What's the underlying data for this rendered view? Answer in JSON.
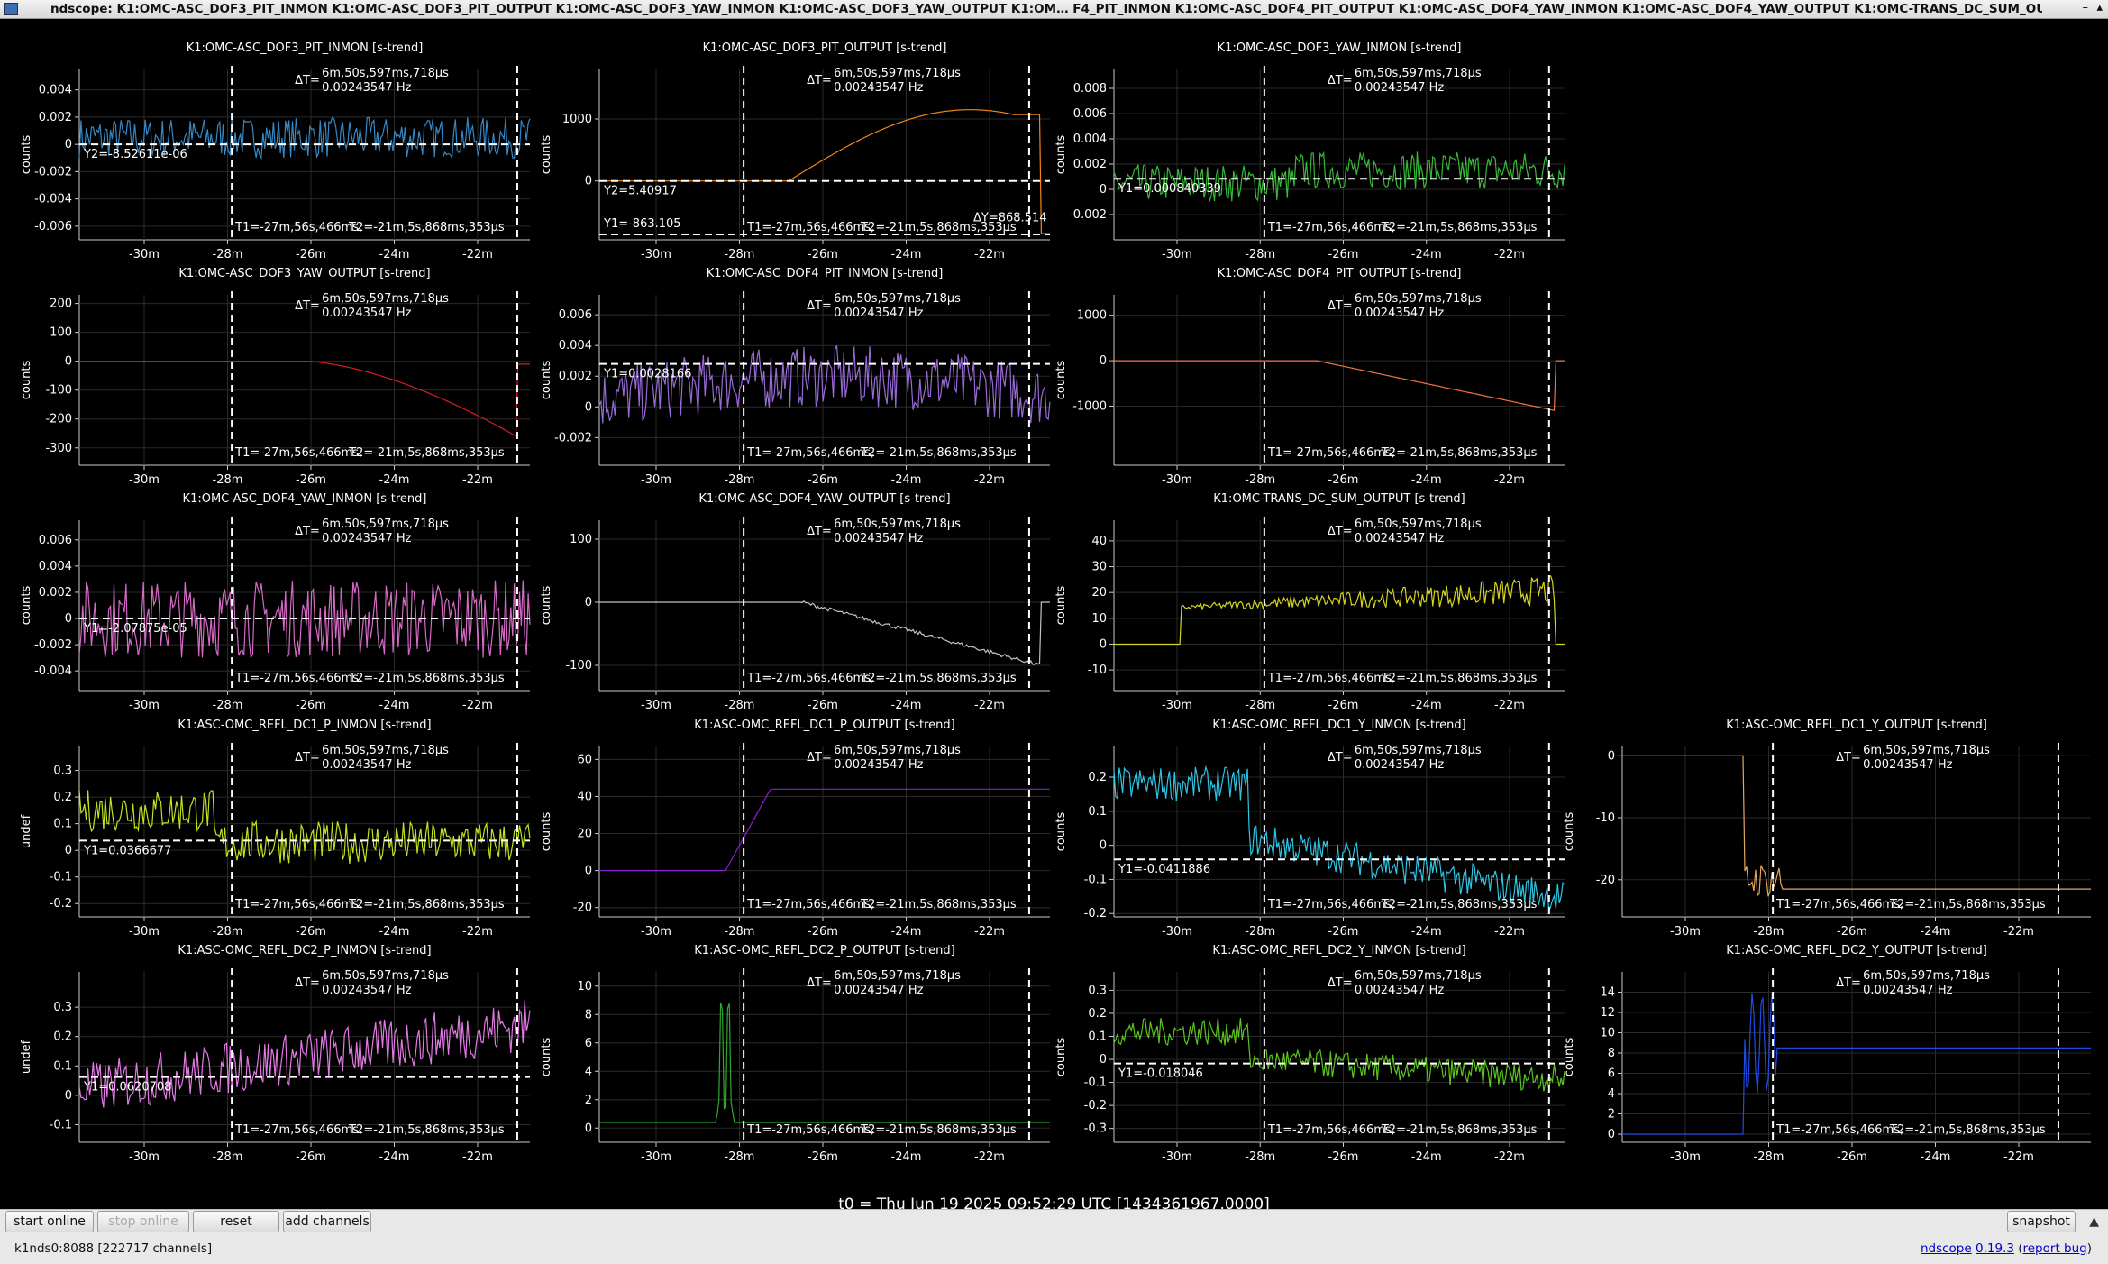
{
  "window": {
    "title": "ndscope: K1:OMC-ASC_DOF3_PIT_INMON K1:OMC-ASC_DOF3_PIT_OUTPUT K1:OMC-ASC_DOF3_YAW_INMON K1:OMC-ASC_DOF3_YAW_OUTPUT K1:OM…  F4_PIT_INMON K1:OMC-ASC_DOF4_PIT_OUTPUT K1:OMC-ASC_DOF4_YAW_INMON K1:OMC-ASC_DOF4_YAW_OUTPUT K1:OMC-TRANS_DC_SUM_OUTPUT",
    "minimize": "–",
    "maximize": "▴"
  },
  "cursor": {
    "dt": "ΔT=",
    "dt_val": "6m,50s,597ms,718µs",
    "dt_hz": "0.00243547 Hz",
    "t1": "T1=-27m,56s,466ms,",
    "t2": "T2=-21m,5s,868ms,353µs"
  },
  "xticks": [
    "-30m",
    "-28m",
    "-26m",
    "-24m",
    "-22m"
  ],
  "plots": [
    {
      "title": "K1:OMC-ASC_DOF3_PIT_INMON [s-trend]",
      "ylabel": "counts",
      "color": "#3a8fd0",
      "ymin": -0.007,
      "ymax": 0.0055,
      "yticks": [
        "0.004",
        "0.002",
        "0",
        "-0.002",
        "-0.004",
        "-0.006"
      ],
      "ytickv": [
        0.004,
        0.002,
        0,
        -0.002,
        -0.004,
        -0.006
      ],
      "ycursor": "Y2=-8.52611e-06",
      "ycurv": 0
    },
    {
      "title": "K1:OMC-ASC_DOF3_PIT_OUTPUT [s-trend]",
      "ylabel": "counts",
      "color": "#ff8c1a",
      "ymin": -950,
      "ymax": 1800,
      "yticks": [
        "1000",
        "0"
      ],
      "ytickv": [
        1000,
        0
      ],
      "ycursor": "Y2=5.40917",
      "ycurv": 0,
      "ycursor2": "Y1=-863.105",
      "ycurv2": -863,
      "dy": "ΔY=868.514"
    },
    {
      "title": "K1:OMC-ASC_DOF3_YAW_INMON [s-trend]",
      "ylabel": "counts",
      "color": "#3ac23a",
      "ymin": -0.004,
      "ymax": 0.0095,
      "yticks": [
        "0.008",
        "0.006",
        "0.004",
        "0.002",
        "0",
        "-0.002"
      ],
      "ytickv": [
        0.008,
        0.006,
        0.004,
        0.002,
        0,
        -0.002
      ],
      "ycursor": "Y1=0.000840339",
      "ycurv": 0.00084
    },
    {
      "title": "K1:OMC-ASC_DOF3_YAW_OUTPUT [s-trend]",
      "ylabel": "counts",
      "color": "#e02020",
      "ymin": -360,
      "ymax": 230,
      "yticks": [
        "200",
        "100",
        "0",
        "-100",
        "-200",
        "-300"
      ],
      "ytickv": [
        200,
        100,
        0,
        -100,
        -200,
        -300
      ]
    },
    {
      "title": "K1:OMC-ASC_DOF4_PIT_INMON [s-trend]",
      "ylabel": "counts",
      "color": "#a070e0",
      "ymin": -0.0038,
      "ymax": 0.0073,
      "yticks": [
        "0.006",
        "0.004",
        "0.002",
        "0",
        "-0.002"
      ],
      "ytickv": [
        0.006,
        0.004,
        0.002,
        0,
        -0.002
      ],
      "ycursor": "Y1=0.0028166",
      "ycurv": 0.0028
    },
    {
      "title": "K1:OMC-ASC_DOF4_PIT_OUTPUT [s-trend]",
      "ylabel": "counts",
      "color": "#ff7a40",
      "ymin": -2300,
      "ymax": 1450,
      "yticks": [
        "1000",
        "0",
        "-1000"
      ],
      "ytickv": [
        1000,
        0,
        -1000
      ]
    },
    {
      "title": "K1:OMC-ASC_DOF4_YAW_INMON [s-trend]",
      "ylabel": "counts",
      "color": "#e070d0",
      "ymin": -0.0055,
      "ymax": 0.0075,
      "yticks": [
        "0.006",
        "0.004",
        "0.002",
        "0",
        "-0.002",
        "-0.004"
      ],
      "ytickv": [
        0.006,
        0.004,
        0.002,
        0,
        -0.002,
        -0.004
      ],
      "ycursor": "Y1=-2.07875e-05",
      "ycurv": 0
    },
    {
      "title": "K1:OMC-ASC_DOF4_YAW_OUTPUT [s-trend]",
      "ylabel": "counts",
      "color": "#cccccc",
      "ymin": -140,
      "ymax": 130,
      "yticks": [
        "100",
        "0",
        "-100"
      ],
      "ytickv": [
        100,
        0,
        -100
      ]
    },
    {
      "title": "K1:OMC-TRANS_DC_SUM_OUTPUT [s-trend]",
      "ylabel": "counts",
      "color": "#e0e020",
      "ymin": -18,
      "ymax": 48,
      "yticks": [
        "40",
        "30",
        "20",
        "10",
        "0",
        "-10"
      ],
      "ytickv": [
        40,
        30,
        20,
        10,
        0,
        -10
      ]
    },
    {
      "title": "K1:ASC-OMC_REFL_DC1_P_INMON [s-trend]",
      "ylabel": "undef",
      "color": "#c8f020",
      "ymin": -0.25,
      "ymax": 0.39,
      "yticks": [
        "0.3",
        "0.2",
        "0.1",
        "0",
        "-0.1",
        "-0.2"
      ],
      "ytickv": [
        0.3,
        0.2,
        0.1,
        0,
        -0.1,
        -0.2
      ],
      "ycursor": "Y1=0.0366677",
      "ycurv": 0.0367
    },
    {
      "title": "K1:ASC-OMC_REFL_DC1_P_OUTPUT [s-trend]",
      "ylabel": "counts",
      "color": "#9020e0",
      "ymin": -25,
      "ymax": 67,
      "yticks": [
        "60",
        "40",
        "20",
        "0",
        "-20"
      ],
      "ytickv": [
        60,
        40,
        20,
        0,
        -20
      ]
    },
    {
      "title": "K1:ASC-OMC_REFL_DC1_Y_INMON [s-trend]",
      "ylabel": "counts",
      "color": "#30d0f0",
      "ymin": -0.21,
      "ymax": 0.29,
      "yticks": [
        "0.2",
        "0.1",
        "0",
        "-0.1",
        "-0.2"
      ],
      "ytickv": [
        0.2,
        0.1,
        0,
        -0.1,
        -0.2
      ],
      "ycursor": "Y1=-0.0411886",
      "ycurv": -0.0412
    },
    {
      "title": "K1:ASC-OMC_REFL_DC1_Y_OUTPUT [s-trend]",
      "ylabel": "counts",
      "color": "#f0b060",
      "ymin": -26,
      "ymax": 1.5,
      "yticks": [
        "0",
        "-10",
        "-20"
      ],
      "ytickv": [
        0,
        -10,
        -20
      ]
    },
    {
      "title": "K1:ASC-OMC_REFL_DC2_P_INMON [s-trend]",
      "ylabel": "undef",
      "color": "#f080f0",
      "ymin": -0.16,
      "ymax": 0.42,
      "yticks": [
        "0.3",
        "0.2",
        "0.1",
        "0",
        "-0.1"
      ],
      "ytickv": [
        0.3,
        0.2,
        0.1,
        0,
        -0.1
      ],
      "ycursor": "Y1=0.0620708",
      "ycurv": 0.062
    },
    {
      "title": "K1:ASC-OMC_REFL_DC2_P_OUTPUT [s-trend]",
      "ylabel": "counts",
      "color": "#30b030",
      "ymin": -1,
      "ymax": 11,
      "yticks": [
        "10",
        "8",
        "6",
        "4",
        "2",
        "0"
      ],
      "ytickv": [
        10,
        8,
        6,
        4,
        2,
        0
      ]
    },
    {
      "title": "K1:ASC-OMC_REFL_DC2_Y_INMON [s-trend]",
      "ylabel": "counts",
      "color": "#60d020",
      "ymin": -0.36,
      "ymax": 0.38,
      "yticks": [
        "0.3",
        "0.2",
        "0.1",
        "0",
        "-0.1",
        "-0.2",
        "-0.3"
      ],
      "ytickv": [
        0.3,
        0.2,
        0.1,
        0,
        -0.1,
        -0.2,
        -0.3
      ],
      "ycursor": "Y1=-0.018046",
      "ycurv": -0.018
    },
    {
      "title": "K1:ASC-OMC_REFL_DC2_Y_OUTPUT [s-trend]",
      "ylabel": "counts",
      "color": "#2050f0",
      "ymin": -0.8,
      "ymax": 16,
      "yticks": [
        "14",
        "12",
        "10",
        "8",
        "6",
        "4",
        "2",
        "0"
      ],
      "ytickv": [
        14,
        12,
        10,
        8,
        6,
        4,
        2,
        0
      ]
    }
  ],
  "t0": "t0 = Thu Jun 19 2025 09:52:29 UTC [1434361967.0000]",
  "toolbar": {
    "start_online": "start online",
    "stop_online": "stop online",
    "reset": "reset",
    "add_channels": "add channels",
    "snapshot": "snapshot"
  },
  "status": {
    "server": "k1nds0:8088  [222717 channels]",
    "app": "ndscope",
    "version": "0.19.3",
    "report": "report bug"
  }
}
